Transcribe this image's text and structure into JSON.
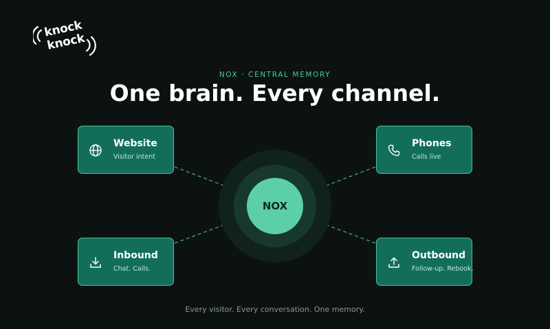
{
  "logo": {
    "line1": "knock",
    "line2": "knock"
  },
  "eyebrow": "NOX · CENTRAL MEMORY",
  "headline": "One brain. Every channel.",
  "hub": {
    "label": "NOX"
  },
  "nodes": [
    {
      "title": "Website",
      "subtitle": "Visitor intent",
      "icon": "globe-icon"
    },
    {
      "title": "Phones",
      "subtitle": "Calls live",
      "icon": "phone-icon"
    },
    {
      "title": "Inbound",
      "subtitle": "Chat. Calls.",
      "icon": "download-icon"
    },
    {
      "title": "Outbound",
      "subtitle": "Follow-up. Rebook.",
      "icon": "upload-icon"
    }
  ],
  "footer": "Every visitor. Every conversation. One memory.",
  "colors": {
    "background": "#0c1212",
    "accent": "#4fc79a",
    "node_fill": "#126e58",
    "hub_fill": "#5dcfa6"
  }
}
